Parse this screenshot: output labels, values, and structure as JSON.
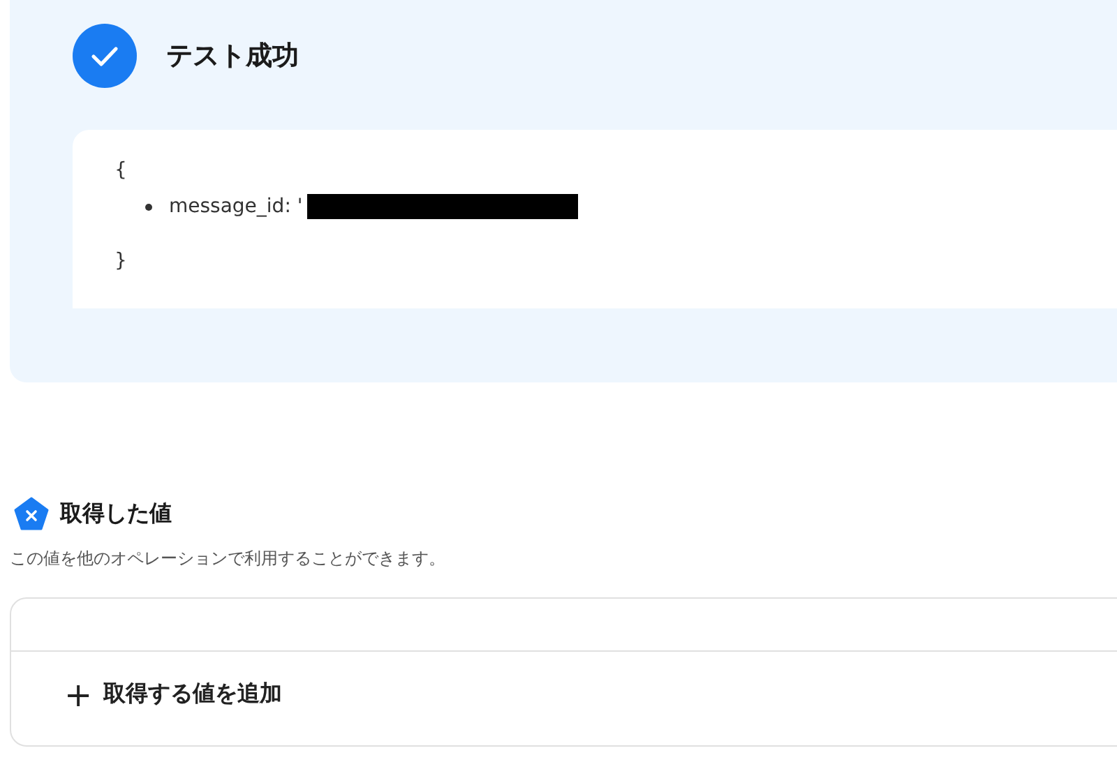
{
  "test_result": {
    "succeeded": true,
    "title": "テスト成功",
    "open_brace": "{",
    "items": [
      {
        "text": "message_id: '"
      }
    ],
    "close_brace": "}"
  },
  "values_section": {
    "title": "取得した値",
    "description": "この値を他のオペレーションで利用することができます。",
    "add_button": {
      "icon": "+",
      "label": "取得する値を追加"
    }
  }
}
